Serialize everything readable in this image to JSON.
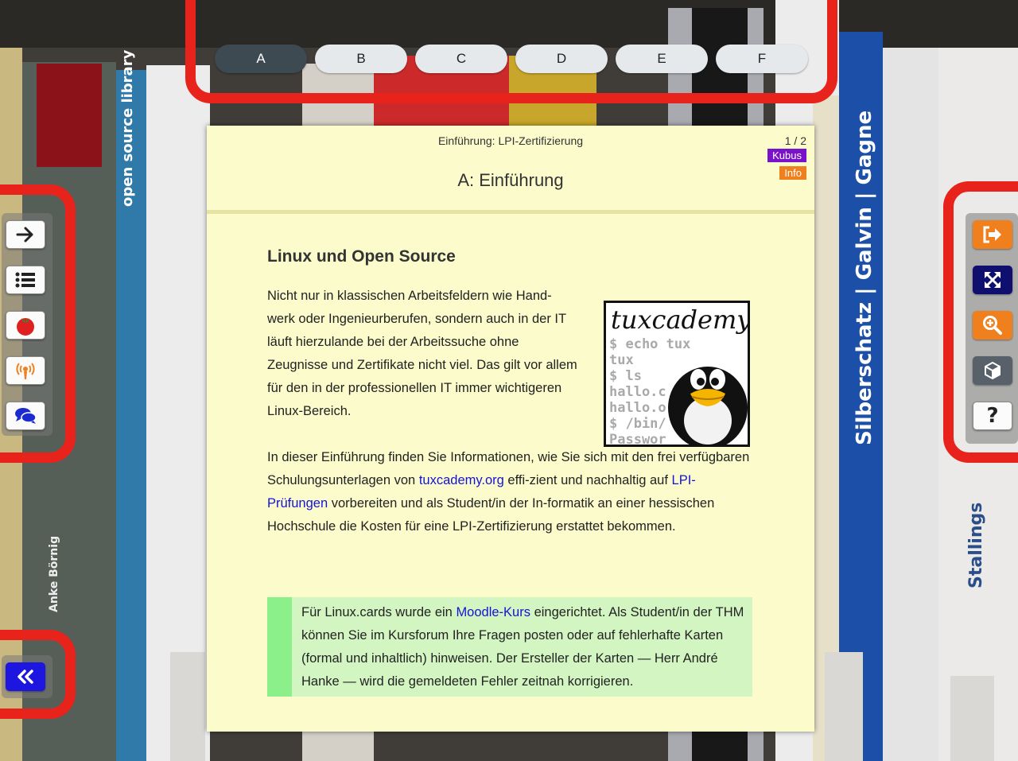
{
  "tabs": [
    {
      "label": "A",
      "active": true
    },
    {
      "label": "B",
      "active": false
    },
    {
      "label": "C",
      "active": false
    },
    {
      "label": "D",
      "active": false
    },
    {
      "label": "E",
      "active": false
    },
    {
      "label": "F",
      "active": false
    }
  ],
  "left_toolbar": {
    "buttons": [
      "arrow-right-icon",
      "list-icon",
      "tomato-icon",
      "podcast-icon",
      "chat-icon"
    ],
    "collapse_button": "double-chevron-left-icon"
  },
  "right_toolbar": {
    "buttons": [
      "exit-icon",
      "expand-icon",
      "zoom-in-icon",
      "cube-icon",
      "question-icon"
    ],
    "help_label": "?"
  },
  "card": {
    "subtitle": "Einführung: LPI-Zertifizierung",
    "page": "1 / 2",
    "badge_kubus": "Kubus",
    "badge_info": "Info",
    "title": "A: Einführung",
    "heading": "Linux und Open Source",
    "para1": "Nicht nur in klassischen Arbeitsfeldern wie Hand-werk oder Ingenieurberufen, sondern auch in der IT läuft hierzulande bei der Arbeitssuche ohne Zeugnisse und Zertifikate nicht viel. Das gilt vor allem für den in der professionellen IT immer wichtigeren Linux-Bereich.",
    "para2_a": "In dieser Einführung finden Sie Informationen, wie Sie sich mit den frei verfügbaren Schulungsunterlagen von",
    "link_tuxcademy": "tuxcademy.org",
    "para2_b": "effi-zient und nachhaltig auf",
    "link_lpi": "LPI-Prüfungen",
    "para2_c": "vorbereiten und als Student/in der In-formatik an einer hessischen Hochschule die Kosten für eine LPI-Zertifizierung erstattet bekommen.",
    "note_a": "Für Linux.cards wurde ein",
    "link_moodle": "Moodle-Kurs",
    "note_b": "eingerichtet. Als Student/in der THM können Sie im Kursforum Ihre Fragen posten oder auf fehlerhafte Karten (formal und inhaltlich) hinweisen. Der Ersteller der Karten — Herr André Hanke — wird die gemeldeten Fehler zeitnah korrigieren.",
    "logo": {
      "wordmark": "tuxcademy",
      "terminal_lines": [
        "$ echo tux",
        "tux",
        "$ ls",
        "hallo.c",
        "hallo.o",
        "$ /bin/",
        "Passwor"
      ]
    }
  },
  "colors": {
    "frame": "#e8231c",
    "card_bg": "#fbfbcb",
    "link": "#1414d4",
    "badge_kubus": "#7a12c9",
    "badge_info": "#f0801e",
    "note_bg": "#d3f5c2",
    "note_bar": "#8cf08a"
  }
}
